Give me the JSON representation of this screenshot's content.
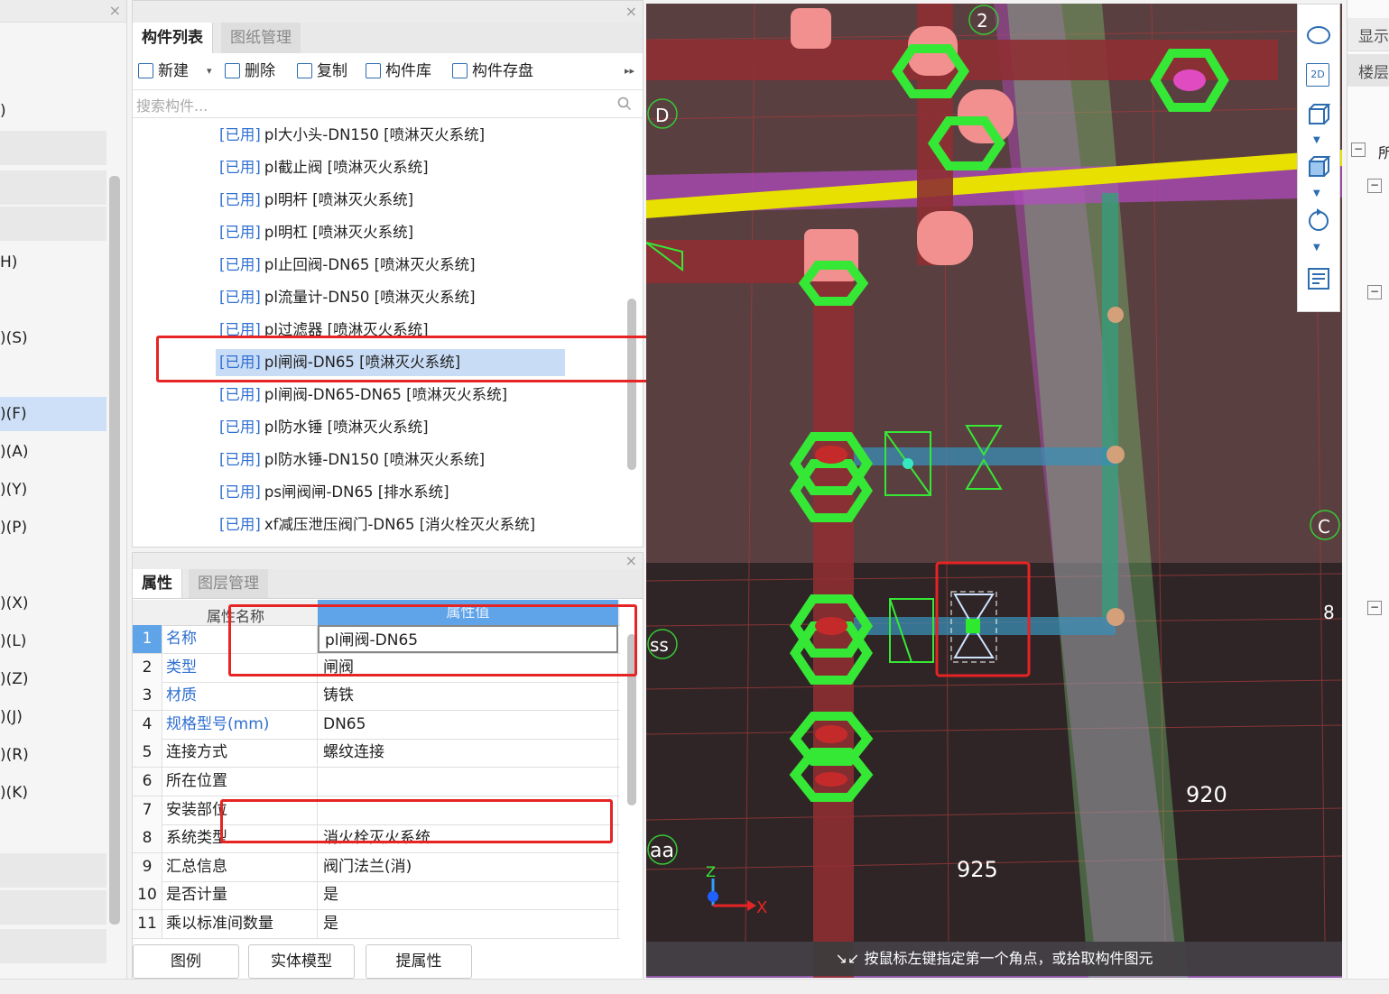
{
  "left_panel": {
    "close": "×",
    "shortcuts": [
      ")",
      "H)",
      ")(S)",
      ")(F)",
      ")(A)",
      ")(Y)",
      ")(P)",
      ")(X)",
      ")(L)",
      ")(Z)",
      ")(J)",
      ")(R)",
      ")(K)"
    ]
  },
  "component_panel": {
    "close": "×",
    "tabs": [
      "构件列表",
      "图纸管理"
    ],
    "toolbar": {
      "new": "新建",
      "new_caret": "▾",
      "delete": "删除",
      "copy": "复制",
      "library": "构件库",
      "save": "构件存盘",
      "more": "▸▸"
    },
    "search_placeholder": "搜索构件...",
    "items": [
      {
        "used": "[已用]",
        "name": "pl大小头-DN150 [喷淋灭火系统]"
      },
      {
        "used": "[已用]",
        "name": "pl截止阀 [喷淋灭火系统]"
      },
      {
        "used": "[已用]",
        "name": "pl明杆 [喷淋灭火系统]"
      },
      {
        "used": "[已用]",
        "name": "pl明杠 [喷淋灭火系统]"
      },
      {
        "used": "[已用]",
        "name": "pl止回阀-DN65 [喷淋灭火系统]"
      },
      {
        "used": "[已用]",
        "name": "pl流量计-DN50 [喷淋灭火系统]"
      },
      {
        "used": "[已用]",
        "name": "pl过滤器 [喷淋灭火系统]"
      },
      {
        "used": "[已用]",
        "name": "pl闸阀-DN65 [喷淋灭火系统]"
      },
      {
        "used": "[已用]",
        "name": "pl闸阀-DN65-DN65 [喷淋灭火系统]"
      },
      {
        "used": "[已用]",
        "name": "pl防水锤 [喷淋灭火系统]"
      },
      {
        "used": "[已用]",
        "name": "pl防水锤-DN150 [喷淋灭火系统]"
      },
      {
        "used": "[已用]",
        "name": "ps闸阀闸-DN65 [排水系统]"
      },
      {
        "used": "[已用]",
        "name": "xf减压泄压阀门-DN65 [消火栓灭火系统]"
      }
    ],
    "selected_index": 7
  },
  "property_panel": {
    "close": "×",
    "tabs": [
      "属性",
      "图层管理"
    ],
    "col_name": "属性名称",
    "col_value": "属性值",
    "rows": [
      {
        "n": "1",
        "name": "名称",
        "value": "pl闸阀-DN65"
      },
      {
        "n": "2",
        "name": "类型",
        "value": "闸阀"
      },
      {
        "n": "3",
        "name": "材质",
        "value": "铸铁"
      },
      {
        "n": "4",
        "name": "规格型号(mm)",
        "value": "DN65"
      },
      {
        "n": "5",
        "name": "连接方式",
        "value": "螺纹连接"
      },
      {
        "n": "6",
        "name": "所在位置",
        "value": ""
      },
      {
        "n": "7",
        "name": "安装部位",
        "value": ""
      },
      {
        "n": "8",
        "name": "系统类型",
        "value": "消火栓灭火系统"
      },
      {
        "n": "9",
        "name": "汇总信息",
        "value": "阀门法兰(消)"
      },
      {
        "n": "10",
        "name": "是否计量",
        "value": "是"
      },
      {
        "n": "11",
        "name": "乘以标准间数量",
        "value": "是"
      }
    ],
    "buttons": [
      "图例",
      "实体模型",
      "提属性"
    ]
  },
  "viewport": {
    "labels": {
      "axis_2": "2",
      "axis_d": "D",
      "axis_c": "C",
      "axis_8": "8",
      "axis_ss": "ss",
      "axis_aa": "aa",
      "dim_920": "920",
      "dim_925": "925",
      "z": "Z",
      "x": "X"
    },
    "hint": "按鼠标左键指定第一个角点，或拾取构件图元",
    "hint_icon": "↘↙"
  },
  "view_tools": {
    "items": [
      "orbit-icon",
      "2d-icon",
      "cube-icon",
      "cube-solid-icon",
      "rotate-icon",
      "layer-list-icon"
    ],
    "label_2d": "2D"
  },
  "right_panel": {
    "tab_display": "显示",
    "tab_floor": "楼层",
    "tree_label": "所",
    "expanders": [
      "−",
      "−",
      "−",
      "−"
    ]
  },
  "colors": {
    "pipe_red": "#8e2f33",
    "pipe_green": "#3a9a7a",
    "pipe_yellow": "#e8e000",
    "fitting_green": "#36e836",
    "purple": "#b34cc4",
    "selection_red": "#e62424",
    "used_blue": "#2f6fd1"
  }
}
